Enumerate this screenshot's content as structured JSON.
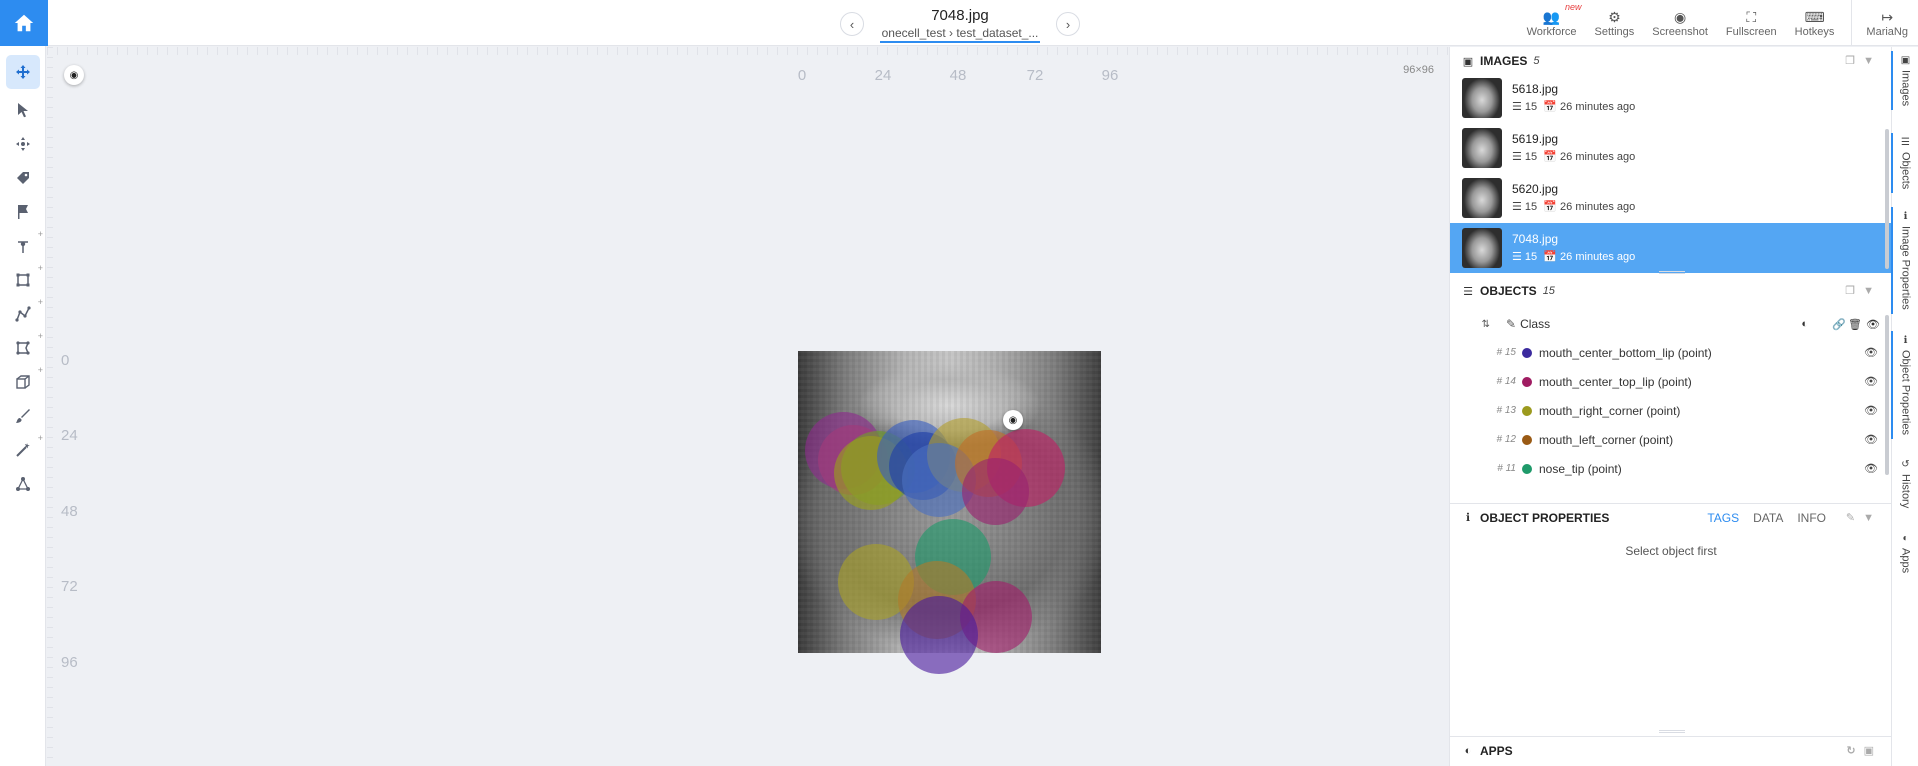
{
  "topbar": {
    "file_title": "7048.jpg",
    "breadcrumb": "onecell_test › test_dataset_...",
    "prev_icon": "chevron-left-icon",
    "next_icon": "chevron-right-icon",
    "tools": [
      {
        "label": "Workforce",
        "icon": "users-icon",
        "badge": "new"
      },
      {
        "label": "Settings",
        "icon": "gear-icon"
      },
      {
        "label": "Screenshot",
        "icon": "camera-icon"
      },
      {
        "label": "Fullscreen",
        "icon": "fullscreen-icon"
      },
      {
        "label": "Hotkeys",
        "icon": "keyboard-icon"
      }
    ],
    "user": {
      "label": "MariaNg",
      "icon": "logout-icon"
    }
  },
  "left_toolbar": {
    "tools": [
      "pan",
      "select",
      "move-points",
      "tag",
      "flag",
      "point",
      "rectangle",
      "polyline",
      "polygon",
      "cuboid",
      "brush",
      "magic-wand",
      "graph"
    ]
  },
  "canvas": {
    "x_ticks": [
      "0",
      "24",
      "48",
      "72",
      "96"
    ],
    "y_ticks": [
      "0",
      "24",
      "48",
      "72",
      "96"
    ],
    "dimensions": "96×96",
    "points": [
      {
        "color": "#8e2b8e"
      },
      {
        "color": "#a33a7a"
      },
      {
        "color": "#6f9e2a"
      },
      {
        "color": "#9a9f1c"
      },
      {
        "color": "#3a5fbf"
      },
      {
        "color": "#1e3fa8"
      },
      {
        "color": "#b3a030"
      },
      {
        "color": "#4a6fc0"
      },
      {
        "color": "#c0702a"
      },
      {
        "color": "#c02066"
      },
      {
        "color": "#9a2270"
      },
      {
        "color": "#1f9a6a"
      },
      {
        "color": "#a9a228"
      },
      {
        "color": "#b07a2a"
      },
      {
        "color": "#a11e6a"
      },
      {
        "color": "#4a1c9c"
      }
    ]
  },
  "images_panel": {
    "title": "IMAGES",
    "count": "5",
    "items": [
      {
        "name": "5618.jpg",
        "objects": "15",
        "time": "26 minutes ago",
        "selected": false
      },
      {
        "name": "5619.jpg",
        "objects": "15",
        "time": "26 minutes ago",
        "selected": false
      },
      {
        "name": "5620.jpg",
        "objects": "15",
        "time": "26 minutes ago",
        "selected": false
      },
      {
        "name": "7048.jpg",
        "objects": "15",
        "time": "26 minutes ago",
        "selected": true
      }
    ]
  },
  "objects_panel": {
    "title": "OBJECTS",
    "count": "15",
    "column_label": "Class",
    "items": [
      {
        "num": "# 15",
        "label": "mouth_center_bottom_lip (point)",
        "color": "#3b2a9e"
      },
      {
        "num": "# 14",
        "label": "mouth_center_top_lip (point)",
        "color": "#a01c62"
      },
      {
        "num": "# 13",
        "label": "mouth_right_corner (point)",
        "color": "#9c9a1e"
      },
      {
        "num": "# 12",
        "label": "mouth_left_corner (point)",
        "color": "#9a5a14"
      },
      {
        "num": "# 11",
        "label": "nose_tip (point)",
        "color": "#1f9a6a"
      }
    ]
  },
  "properties_panel": {
    "title": "OBJECT PROPERTIES",
    "tabs": [
      "TAGS",
      "DATA",
      "INFO"
    ],
    "active_tab": "TAGS",
    "empty_message": "Select object first"
  },
  "apps_panel": {
    "title": "APPS"
  },
  "vertical_tabs": [
    "Images",
    "Objects",
    "Image Properties",
    "Object Properties",
    "History",
    "Apps"
  ],
  "colors": {
    "accent": "#2d8cf0",
    "selected_row": "#54a6f3"
  }
}
